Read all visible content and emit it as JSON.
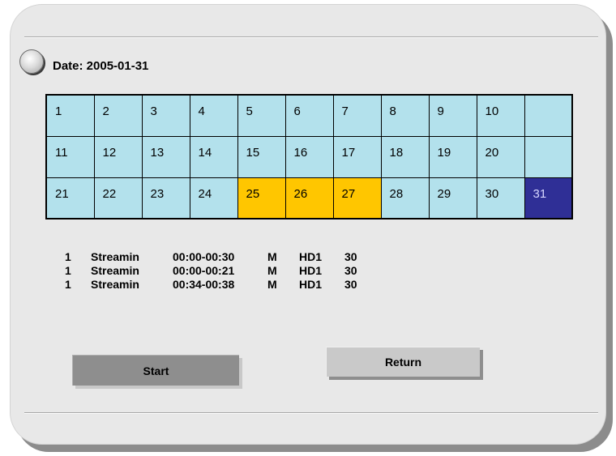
{
  "header": {
    "date_label": "Date: 2005-01-31"
  },
  "calendar": {
    "rows": [
      [
        "1",
        "2",
        "3",
        "4",
        "5",
        "6",
        "7",
        "8",
        "9",
        "10",
        ""
      ],
      [
        "11",
        "12",
        "13",
        "14",
        "15",
        "16",
        "17",
        "18",
        "19",
        "20",
        ""
      ],
      [
        "21",
        "22",
        "23",
        "24",
        "25",
        "26",
        "27",
        "28",
        "29",
        "30",
        "31"
      ]
    ],
    "highlighted_days": [
      "25",
      "26",
      "27"
    ],
    "selected_day": "31",
    "colors": {
      "cell": "#b3e1ec",
      "highlight": "#ffc600",
      "selected": "#2f2f96"
    }
  },
  "records": [
    {
      "no": "1",
      "type": "Streamin",
      "time": "00:00-00:30",
      "mode": "M",
      "cam": "HD1",
      "rate": "30"
    },
    {
      "no": "1",
      "type": "Streamin",
      "time": "00:00-00:21",
      "mode": "M",
      "cam": "HD1",
      "rate": "30"
    },
    {
      "no": "1",
      "type": "Streamin",
      "time": "00:34-00:38",
      "mode": "M",
      "cam": "HD1",
      "rate": "30"
    }
  ],
  "buttons": {
    "start_label": "Start",
    "return_label": "Return"
  }
}
